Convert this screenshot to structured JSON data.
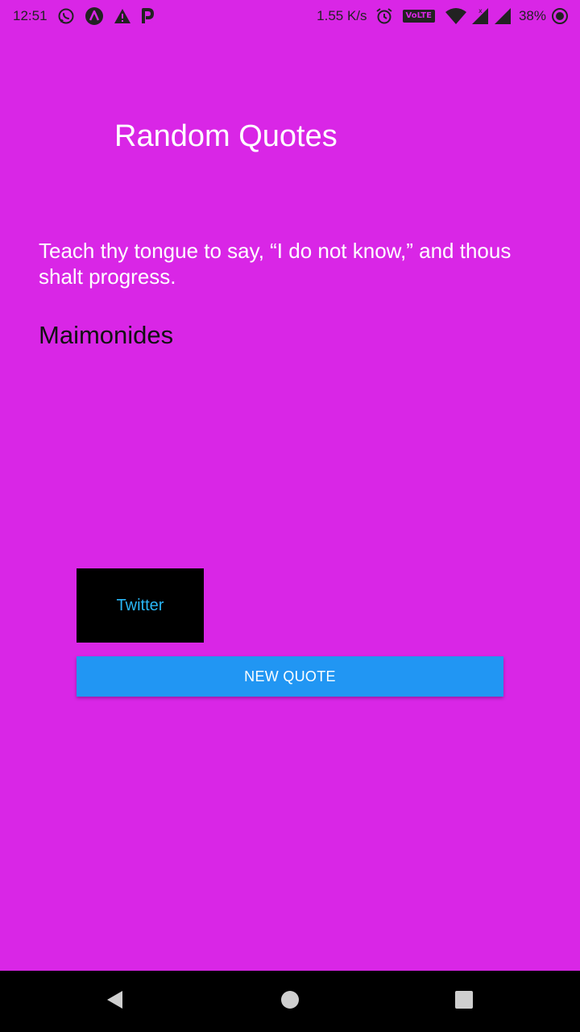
{
  "status_bar": {
    "time": "12:51",
    "network_speed": "1.55 K/s",
    "volte_label": "VoLTE",
    "battery_percent": "38%",
    "icons": [
      "whatsapp-icon",
      "app-notification-icon",
      "warning-icon",
      "paytm-icon",
      "alarm-icon",
      "wifi-icon",
      "signal-icon",
      "signal-icon",
      "battery-saver-icon"
    ]
  },
  "app": {
    "title": "Random Quotes",
    "background_color": "#d926e6"
  },
  "quote": {
    "text": "Teach thy tongue to say, “I do not know,” and thous shalt progress.",
    "author": "Maimonides"
  },
  "buttons": {
    "twitter_label": "Twitter",
    "new_quote_label": "NEW QUOTE",
    "new_quote_color": "#2196f3",
    "twitter_text_color": "#29b6f6"
  },
  "nav_bar": {
    "icons": [
      "back-icon",
      "home-icon",
      "recents-icon"
    ]
  }
}
